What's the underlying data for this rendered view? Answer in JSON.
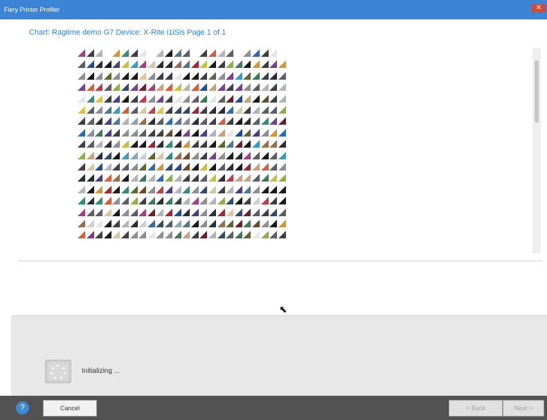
{
  "window": {
    "title": "Fiery Printer Profiler",
    "close_label": "✕"
  },
  "chart_header": {
    "text": "Chart: Ragtime demo G7  Device: X-Rite i1iSis  Page 1 of 1"
  },
  "status": {
    "text": "Initializing ..."
  },
  "footer": {
    "help_label": "?",
    "cancel_label": "Cancel",
    "back_label": "< Back",
    "next_label": "Next >"
  },
  "swatches": {
    "rows": 17,
    "cols": 24,
    "palette": [
      "#1a1a1a",
      "#2a2d33",
      "#3d3f46",
      "#5a5e66",
      "#8d8f95",
      "#b2b4b8",
      "#cfcfcf",
      "#e6e6e6",
      "#3a7a56",
      "#2f8e73",
      "#3a9ac4",
      "#2a6bb3",
      "#1f4b9c",
      "#4c3b86",
      "#7a3f8e",
      "#a53f82",
      "#c53a4b",
      "#d85d3b",
      "#d89436",
      "#e2c33c",
      "#c6c13f",
      "#8bb04a",
      "#5a6a2f",
      "#6b4a2a",
      "#9b6b4a",
      "#c9a27a",
      "#d9c7a4",
      "#9f2837",
      "#6d1f2b",
      "#2e4b6b",
      "#4e7793",
      "#85a7b6"
    ]
  }
}
